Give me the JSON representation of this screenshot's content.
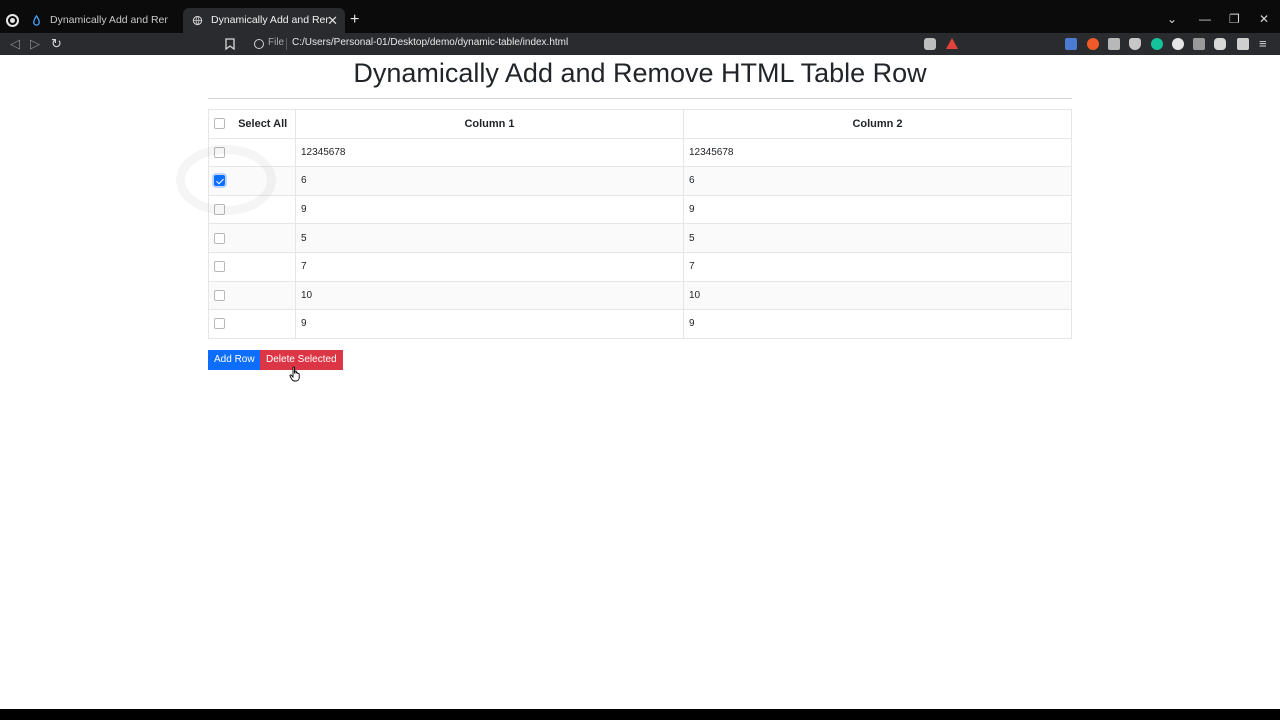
{
  "browser": {
    "tabs": [
      {
        "title": "Dynamically Add and Remove HTML Ta",
        "active": false
      },
      {
        "title": "Dynamically Add and Remove Tab",
        "active": true
      }
    ],
    "address": {
      "scheme_label": "File",
      "url": "C:/Users/Personal-01/Desktop/demo/dynamic-table/index.html"
    }
  },
  "page": {
    "title": "Dynamically Add and Remove HTML Table Row",
    "table": {
      "select_all_label": "Select All",
      "headers": [
        "Column 1",
        "Column 2"
      ],
      "rows": [
        {
          "checked": false,
          "c1": "12345678",
          "c2": "12345678"
        },
        {
          "checked": true,
          "c1": "6",
          "c2": "6"
        },
        {
          "checked": false,
          "c1": "9",
          "c2": "9"
        },
        {
          "checked": false,
          "c1": "5",
          "c2": "5"
        },
        {
          "checked": false,
          "c1": "7",
          "c2": "7"
        },
        {
          "checked": false,
          "c1": "10",
          "c2": "10"
        },
        {
          "checked": false,
          "c1": "9",
          "c2": "9"
        }
      ]
    },
    "buttons": {
      "add": "Add Row",
      "delete": "Delete Selected"
    }
  },
  "colors": {
    "primary": "#0d6efd",
    "danger": "#dc3545",
    "chrome_bg": "#2a2b2f"
  }
}
